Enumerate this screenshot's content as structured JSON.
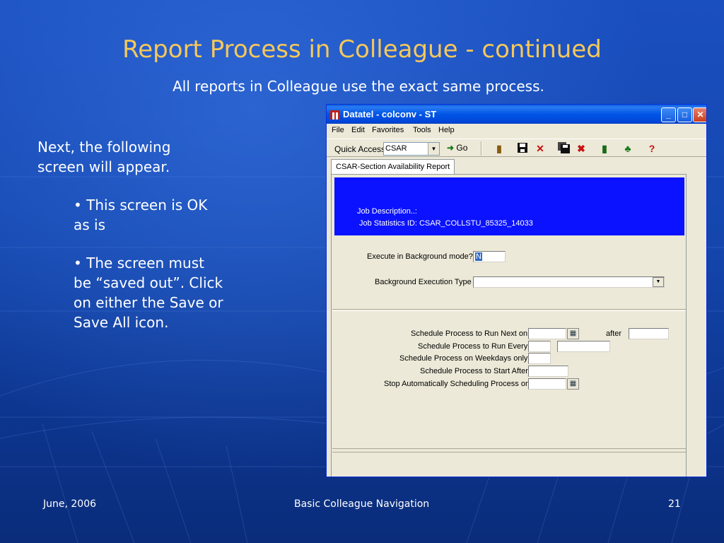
{
  "slide": {
    "title": "Report Process in Colleague - continued",
    "subtitle": "All reports in Colleague use the exact same process.",
    "intro_line1": "Next, the following",
    "intro_line2": "screen will appear.",
    "bullet1_line1": "• This screen is OK",
    "bullet1_line2": "as is",
    "bullet2_line1": "• The screen must",
    "bullet2_line2": "be “saved out”.  Click",
    "bullet2_line3": "on either the Save or",
    "bullet2_line4": "Save All icon.",
    "footer_date": "June, 2006",
    "footer_center": "Basic Colleague Navigation",
    "footer_page": "21",
    "colors": {
      "title": "#f5c85a",
      "background": "#1446ad",
      "text": "#ffffff"
    }
  },
  "window": {
    "title": "Datatel - colconv - ST",
    "minimize": "_",
    "maximize": "□",
    "close": "✕",
    "menu": {
      "file": "File",
      "edit": "Edit",
      "favorites": "Favorites",
      "tools": "Tools",
      "help": "Help"
    },
    "toolbar": {
      "quick_access_label": "Quick Access",
      "quick_access_value": "CSAR",
      "go_label": "Go",
      "icons": [
        "exit-icon",
        "save-icon",
        "cancel-icon",
        "save-all-icon",
        "cancel-all-icon",
        "trash-icon",
        "tree-icon",
        "help-icon"
      ]
    },
    "tab_label": "CSAR-Section Availability Report",
    "header": {
      "job_description_label": "Job Description..:",
      "job_statistics_label": "Job Statistics ID:",
      "job_statistics_value": "CSAR_COLLSTU_85325_14033",
      "color": "#0a12ff"
    },
    "form": {
      "execute_bg_label": "Execute in Background mode?",
      "execute_bg_value": "N",
      "bg_exec_type_label": "Background Execution Type",
      "bg_exec_type_value": "",
      "schedule_next_label": "Schedule Process to Run Next on",
      "after_label": "after",
      "schedule_every_label": "Schedule Process to Run Every",
      "weekdays_label": "Schedule Process on Weekdays only",
      "start_after_label": "Schedule Process to Start After",
      "stop_label": "Stop Automatically Scheduling Process on"
    }
  }
}
